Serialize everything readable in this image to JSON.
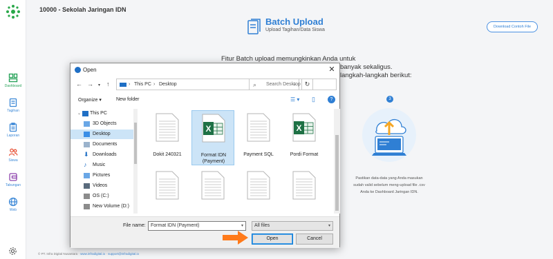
{
  "header": {
    "school": "10000 - Sekolah Jaringan IDN"
  },
  "sidebar": {
    "items": [
      {
        "label": "Dashboard",
        "icon": "dashboard-icon"
      },
      {
        "label": "Tagihan",
        "icon": "bill-icon"
      },
      {
        "label": "Laporan",
        "icon": "report-icon"
      },
      {
        "label": "Siswa",
        "icon": "students-icon"
      },
      {
        "label": "Tabungan",
        "icon": "savings-icon"
      },
      {
        "label": "Web",
        "icon": "globe-icon"
      }
    ],
    "bottom_icon": "gear-icon"
  },
  "page": {
    "title": "Batch Upload",
    "subtitle": "Upload Tagihan/Data Siswa",
    "download_button": "Download Contoh File",
    "intro_lines": [
      "Fitur Batch upload memungkinkan Anda untuk",
      "banyak sekaligus.",
      "langkah-langkah berikut:"
    ],
    "step_number": "3",
    "step_text": [
      "Pastikan data-data yang Anda masukan",
      "sudah valid sebelum meng-upload file .csv",
      "Anda ke Dashboard Jaringan IDN."
    ]
  },
  "footer": {
    "copyright": "© PT. Infra Digital Nusantara",
    "site": "www.infradigital.io",
    "email": "support@infradigital.io"
  },
  "dialog": {
    "title": "Open",
    "breadcrumb": [
      "This PC",
      "Desktop"
    ],
    "search_placeholder": "Search Desktop",
    "organize": "Organize",
    "new_folder": "New folder",
    "tree": [
      {
        "label": "This PC",
        "icon": "computer-icon"
      },
      {
        "label": "3D Objects",
        "icon": "3d-objects-icon"
      },
      {
        "label": "Desktop",
        "icon": "desktop-icon",
        "selected": true
      },
      {
        "label": "Documents",
        "icon": "documents-icon"
      },
      {
        "label": "Downloads",
        "icon": "downloads-icon"
      },
      {
        "label": "Music",
        "icon": "music-icon"
      },
      {
        "label": "Pictures",
        "icon": "pictures-icon"
      },
      {
        "label": "Videos",
        "icon": "videos-icon"
      },
      {
        "label": "OS (C:)",
        "icon": "drive-icon"
      },
      {
        "label": "New Volume (D:)",
        "icon": "drive-icon"
      }
    ],
    "files": [
      {
        "name": "Dokit 240321",
        "type": "text"
      },
      {
        "name": "Format IDN (Payment)",
        "type": "excel",
        "selected": true
      },
      {
        "name": "Payment SQL",
        "type": "text"
      },
      {
        "name": "Pordi Format",
        "type": "excel"
      },
      {
        "name": "",
        "type": "text"
      },
      {
        "name": "",
        "type": "text"
      },
      {
        "name": "",
        "type": "text"
      },
      {
        "name": "",
        "type": "text"
      }
    ],
    "file_name_label": "File name:",
    "file_name_value": "Format IDN (Payment)",
    "file_type": "All files",
    "open_button": "Open",
    "cancel_button": "Cancel"
  },
  "colors": {
    "accent": "#2f7fd4",
    "excel": "#1e7145",
    "highlight": "#ff7a1a"
  }
}
